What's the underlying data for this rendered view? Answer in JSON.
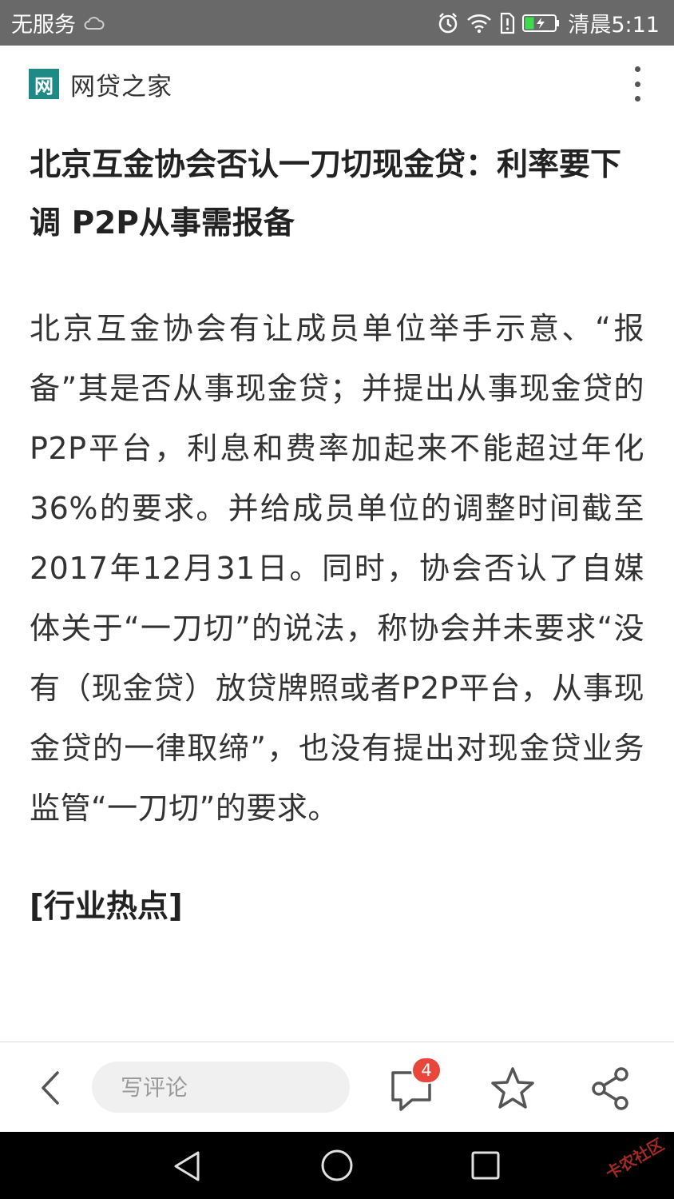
{
  "status_bar": {
    "carrier": "无服务",
    "time": "清晨5:11",
    "icons": [
      "cloud-icon",
      "alarm-icon",
      "wifi-icon",
      "sim-alert-icon",
      "battery-icon"
    ]
  },
  "header": {
    "logo_text": "网",
    "app_name": "网贷之家",
    "logo_color": "#1e8a85"
  },
  "article": {
    "headline": "北京互金协会否认一刀切现金贷：利率要下调 P2P从事需报备",
    "body": "北京互金协会有让成员单位举手示意、“报备”其是否从事现金贷；并提出从事现金贷的P2P平台，利息和费率加起来不能超过年化36%的要求。并给成员单位的调整时间截至2017年12月31日。同时，协会否认了自媒体关于“一刀切”的说法，称协会并未要求“没有（现金贷）放贷牌照或者P2P平台，从事现金贷的一律取缔”，也没有提出对现金贷业务监管“一刀切”的要求。",
    "section_title": "[行业热点]"
  },
  "action_bar": {
    "comment_placeholder": "写评论",
    "comment_count": "4",
    "badge_color": "#e8463b"
  },
  "watermark": "卡农社区"
}
